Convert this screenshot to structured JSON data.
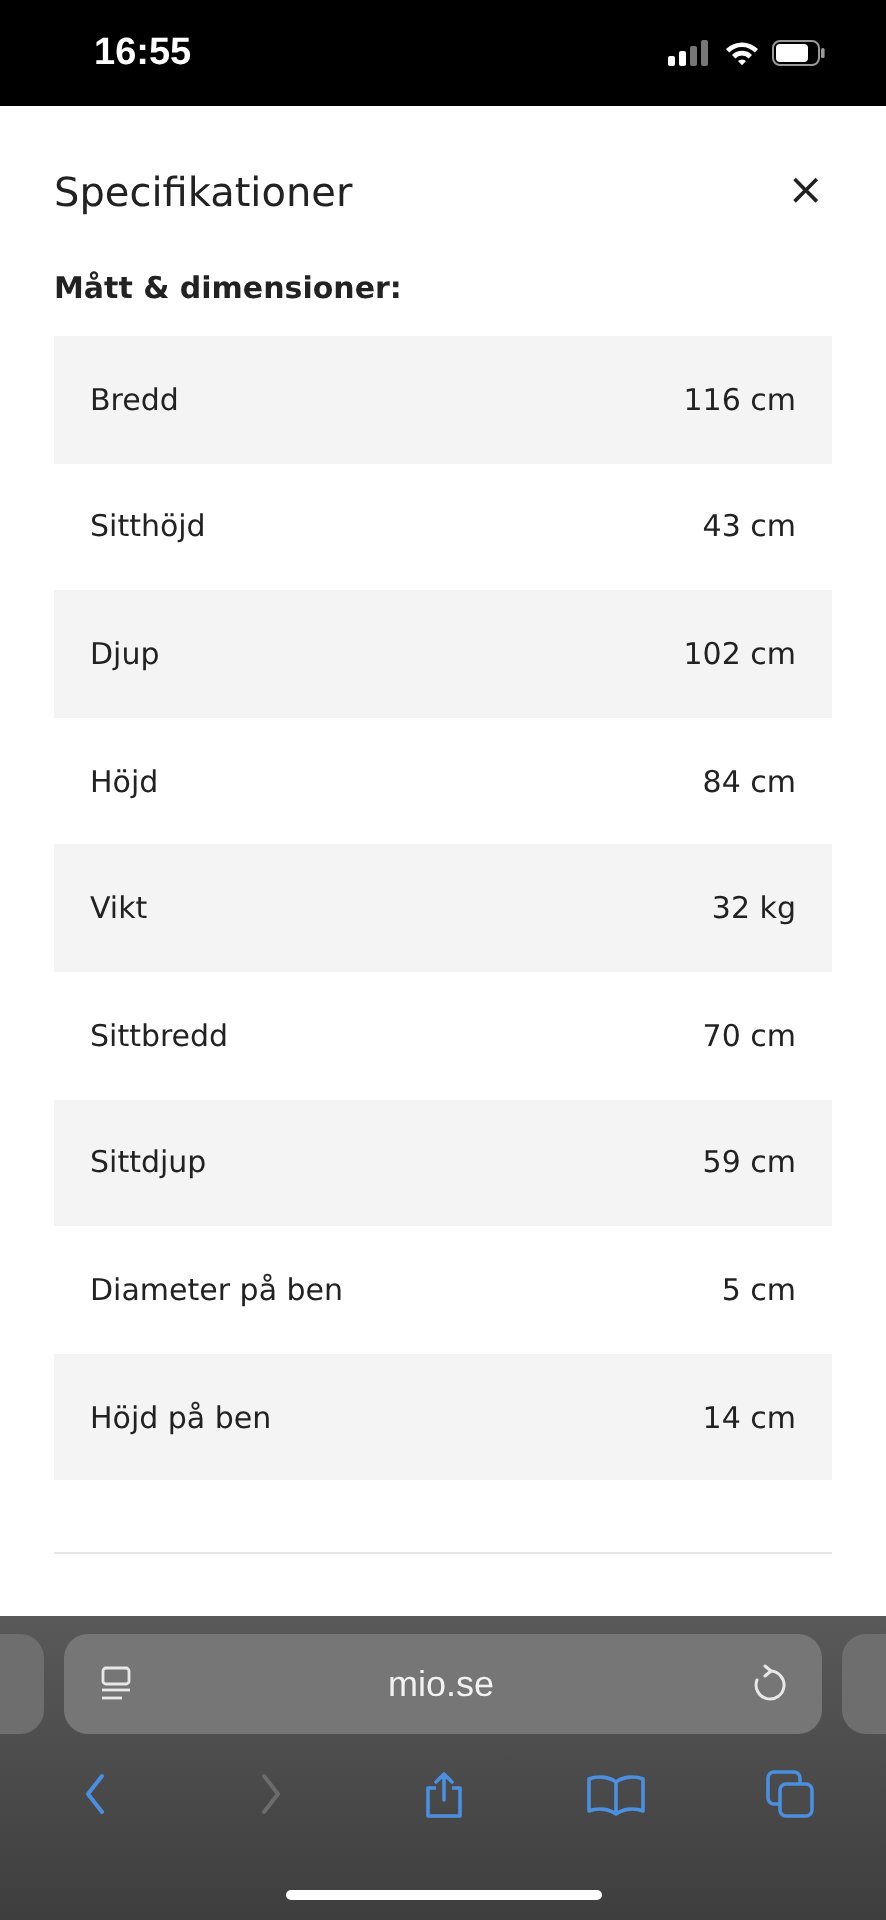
{
  "status_bar": {
    "time": "16:55"
  },
  "sheet": {
    "title": "Specifikationer",
    "close": "×",
    "section": "Mått & dimensioner:",
    "rows": [
      {
        "label": "Bredd",
        "value": "116 cm"
      },
      {
        "label": "Sitthöjd",
        "value": "43 cm"
      },
      {
        "label": "Djup",
        "value": "102 cm"
      },
      {
        "label": "Höjd",
        "value": "84 cm"
      },
      {
        "label": "Vikt",
        "value": "32 kg"
      },
      {
        "label": "Sittbredd",
        "value": "70 cm"
      },
      {
        "label": "Sittdjup",
        "value": "59 cm"
      },
      {
        "label": "Diameter på ben",
        "value": "5 cm"
      },
      {
        "label": "Höjd på ben",
        "value": "14 cm"
      }
    ]
  },
  "browser": {
    "url": "mio.se",
    "toolbar": [
      {
        "kind": "back",
        "disabled": false
      },
      {
        "kind": "forward",
        "disabled": true
      },
      {
        "kind": "share",
        "disabled": false
      },
      {
        "kind": "bookmarks",
        "disabled": false
      },
      {
        "kind": "tabs",
        "disabled": false
      }
    ]
  }
}
